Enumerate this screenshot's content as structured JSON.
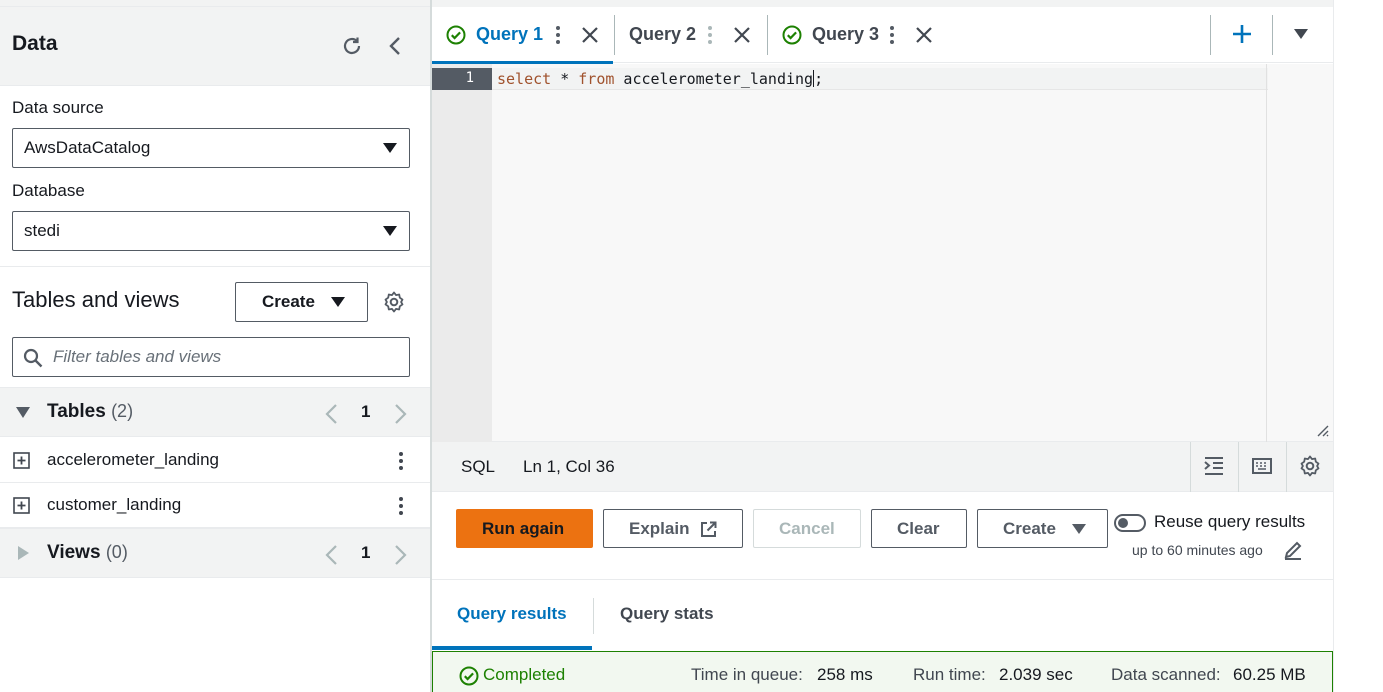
{
  "left_panel": {
    "title": "Data",
    "data_source": {
      "label": "Data source",
      "value": "AwsDataCatalog"
    },
    "database": {
      "label": "Database",
      "value": "stedi"
    },
    "tables_and_views": {
      "title": "Tables and views",
      "create_label": "Create",
      "filter_placeholder": "Filter tables and views"
    },
    "tables_group": {
      "label": "Tables",
      "count": "(2)",
      "page": "1"
    },
    "tables": [
      {
        "name": "accelerometer_landing"
      },
      {
        "name": "customer_landing"
      }
    ],
    "views_group": {
      "label": "Views",
      "count": "(0)",
      "page": "1"
    }
  },
  "query_tabs": [
    {
      "label": "Query 1",
      "status": "completed",
      "active": true
    },
    {
      "label": "Query 2",
      "status": "none",
      "active": false
    },
    {
      "label": "Query 3",
      "status": "completed",
      "active": false
    }
  ],
  "editor": {
    "line_number": "1",
    "code": {
      "kw1": "select",
      "mid": " * ",
      "kw2": "from",
      "rest": " accelerometer_landing",
      "end": ";"
    },
    "language": "SQL",
    "cursor_position": "Ln 1, Col 36"
  },
  "actions": {
    "run_again": "Run again",
    "explain": "Explain",
    "cancel": "Cancel",
    "clear": "Clear",
    "create": "Create",
    "reuse_label": "Reuse query results",
    "reuse_sub": "up to 60 minutes ago"
  },
  "result_tabs": {
    "results": "Query results",
    "stats": "Query stats"
  },
  "status": {
    "state": "Completed",
    "time_in_queue_label": "Time in queue:",
    "time_in_queue": "258 ms",
    "run_time_label": "Run time:",
    "run_time": "2.039 sec",
    "data_scanned_label": "Data scanned:",
    "data_scanned": "60.25 MB"
  },
  "colors": {
    "accent": "#0073bb",
    "primary_button": "#ec7211",
    "success": "#1d8102"
  }
}
